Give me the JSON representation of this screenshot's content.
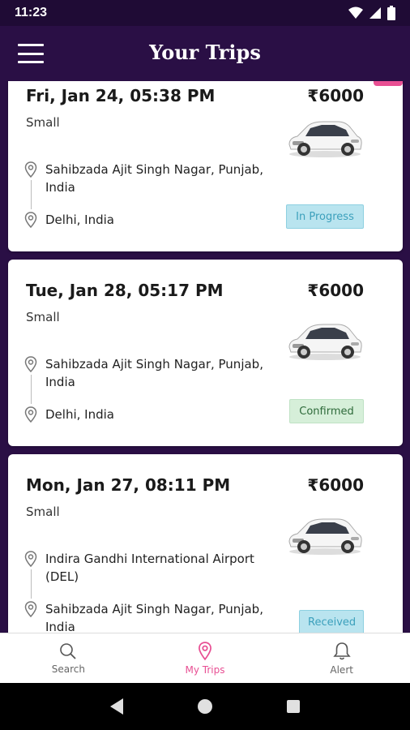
{
  "status_bar": {
    "time": "11:23"
  },
  "app_bar": {
    "title": "Your Trips"
  },
  "trips": [
    {
      "date": "Fri, Jan 24, 05:38 PM",
      "price": "₹6000",
      "car_type": "Small",
      "pickup": "Sahibzada Ajit Singh Nagar, Punjab, India",
      "drop": "Delhi, India",
      "status": "In Progress"
    },
    {
      "date": "Tue, Jan 28, 05:17 PM",
      "price": "₹6000",
      "car_type": "Small",
      "pickup": "Sahibzada Ajit Singh Nagar, Punjab, India",
      "drop": "Delhi, India",
      "status": "Confirmed"
    },
    {
      "date": "Mon, Jan 27, 08:11 PM",
      "price": "₹6000",
      "car_type": "Small",
      "pickup": "Indira Gandhi International Airport (DEL)",
      "drop": "Sahibzada Ajit Singh Nagar, Punjab, India",
      "status": "Received"
    }
  ],
  "bottom_nav": {
    "items": [
      {
        "label": "Search",
        "icon": "search-icon"
      },
      {
        "label": "My Trips",
        "icon": "location-pin-icon"
      },
      {
        "label": "Alert",
        "icon": "bell-icon"
      }
    ],
    "active_index": 1
  },
  "colors": {
    "header_bg": "#2a0f45",
    "accent": "#e84f93",
    "in_progress": "#b9e4ef",
    "confirmed": "#d6efd9"
  }
}
